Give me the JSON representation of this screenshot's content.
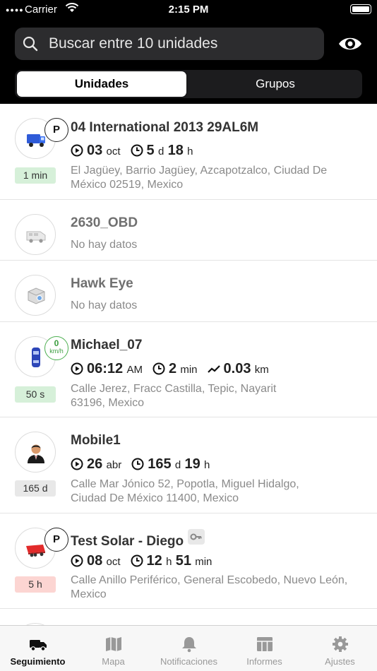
{
  "status_bar": {
    "carrier": "Carrier",
    "time": "2:15 PM"
  },
  "search": {
    "placeholder": "Buscar entre 10 unidades"
  },
  "segments": {
    "units": "Unidades",
    "groups": "Grupos"
  },
  "units": [
    {
      "name": "04 International 2013 29AL6M",
      "icon": "truck-icon",
      "status_overlay": "P",
      "badge": "1 min",
      "stats": {
        "date_day": "03",
        "date_month": "oct",
        "dur_a": "5",
        "dur_a_unit": "d",
        "dur_b": "18",
        "dur_b_unit": "h"
      },
      "address": "El Jagüey, Barrio Jagüey, Azcapotzalco, Ciudad De México 02519, Mexico"
    },
    {
      "name": "2630_OBD",
      "icon": "van-icon",
      "no_data": "No hay datos"
    },
    {
      "name": "Hawk Eye",
      "icon": "device-icon",
      "no_data": "No hay datos"
    },
    {
      "name": "Michael_07",
      "icon": "car-icon",
      "speed_value": "0",
      "speed_unit": "km/h",
      "badge": "50 s",
      "stats": {
        "time": "06:12",
        "time_ampm": "AM",
        "dur": "2",
        "dur_unit": "min",
        "dist": "0.03",
        "dist_unit": "km"
      },
      "address": "Calle Jerez, Fracc Castilla, Tepic, Nayarit 63196, Mexico"
    },
    {
      "name": "Mobile1",
      "icon": "person-icon",
      "badge": "165 d",
      "stats": {
        "date_day": "26",
        "date_month": "abr",
        "dur_a": "165",
        "dur_a_unit": "d",
        "dur_b": "19",
        "dur_b_unit": "h"
      },
      "address": "Calle Mar Jónico 52, Popotla, Miguel Hidalgo, Ciudad De México 11400, Mexico"
    },
    {
      "name": "Test Solar - Diego",
      "icon": "trailer-icon",
      "status_overlay": "P",
      "badge": "5 h",
      "stats": {
        "date_day": "08",
        "date_month": "oct",
        "dur_a": "12",
        "dur_a_unit": "h",
        "dur_b": "51",
        "dur_b_unit": "min"
      },
      "address": "Calle Anillo Periférico, General Escobedo, Nuevo León, Mexico"
    }
  ],
  "tabs": [
    {
      "label": "Seguimiento",
      "icon": "truck-tab-icon",
      "active": true
    },
    {
      "label": "Mapa",
      "icon": "map-icon"
    },
    {
      "label": "Notificaciones",
      "icon": "bell-icon"
    },
    {
      "label": "Informes",
      "icon": "table-icon"
    },
    {
      "label": "Ajustes",
      "icon": "gear-icon"
    }
  ],
  "colors": {
    "header_bg": "#000000",
    "badge_green": "#d6f0d9",
    "badge_gray": "#e8e8e8",
    "badge_red": "#fcd5d2",
    "speed_green": "#4caf50"
  }
}
